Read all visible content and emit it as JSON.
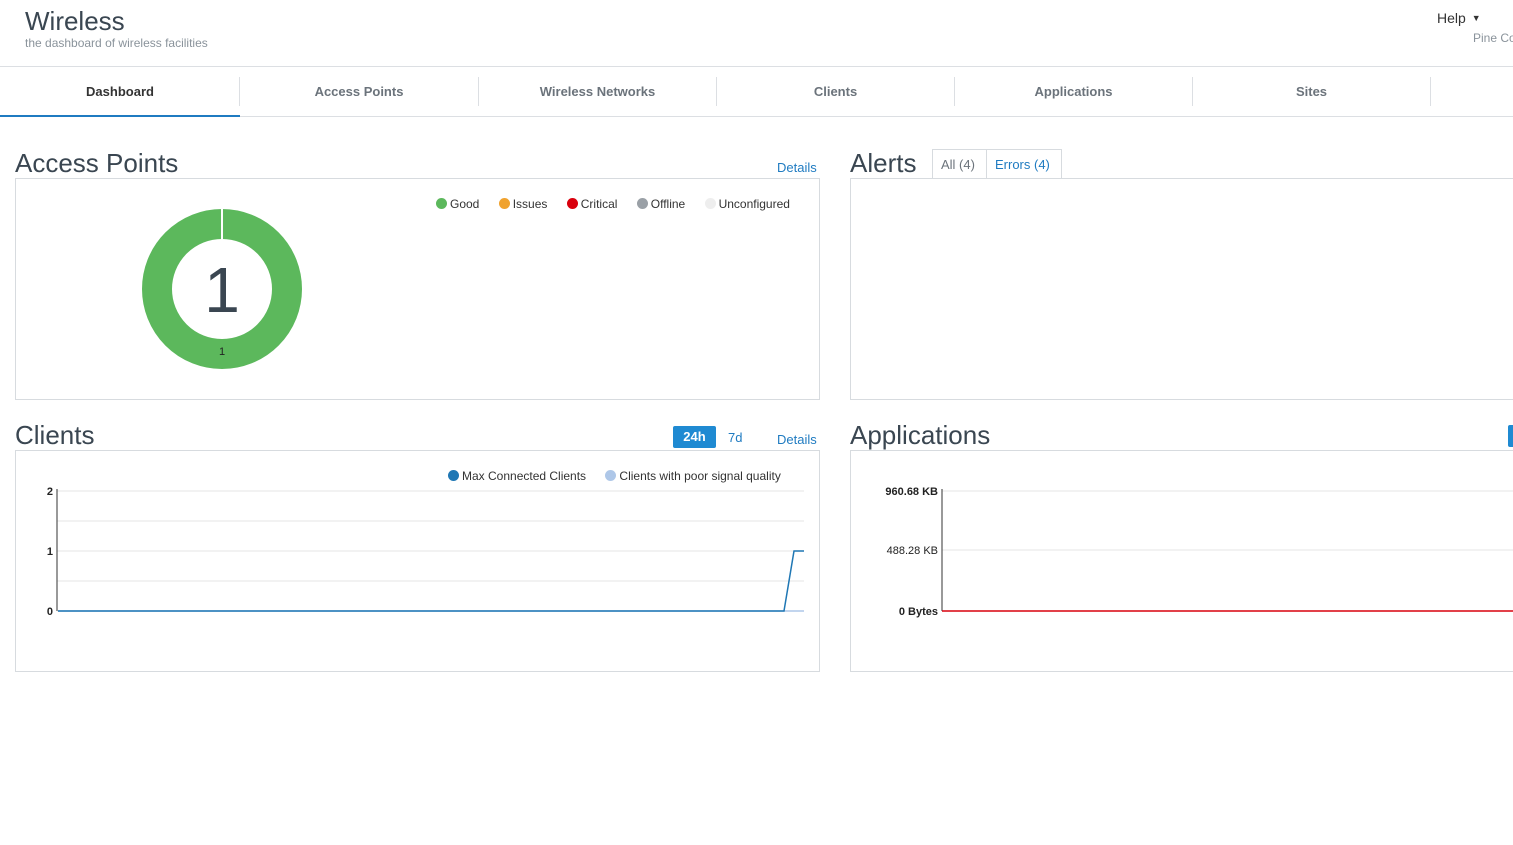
{
  "header": {
    "title": "Wireless",
    "subtitle": "the dashboard of wireless facilities",
    "help_label": "Help",
    "org_name": "Pine Co"
  },
  "tabs": [
    {
      "label": "Dashboard",
      "active": true
    },
    {
      "label": "Access Points",
      "active": false
    },
    {
      "label": "Wireless Networks",
      "active": false
    },
    {
      "label": "Clients",
      "active": false
    },
    {
      "label": "Applications",
      "active": false
    },
    {
      "label": "Sites",
      "active": false
    }
  ],
  "access_points": {
    "title": "Access Points",
    "details_label": "Details",
    "total": "1",
    "legend": [
      {
        "label": "Good",
        "color": "#5cb85c"
      },
      {
        "label": "Issues",
        "color": "#f0a22e"
      },
      {
        "label": "Critical",
        "color": "#d9000d"
      },
      {
        "label": "Offline",
        "color": "#9aa0a6"
      },
      {
        "label": "Unconfigured",
        "color": "#eeeeee"
      }
    ]
  },
  "alerts": {
    "title": "Alerts",
    "tab_all": "All (4)",
    "tab_errors": "Errors (4)"
  },
  "clients": {
    "title": "Clients",
    "range_24h": "24h",
    "range_7d": "7d",
    "details_label": "Details",
    "legend": [
      {
        "label": "Max Connected Clients",
        "color": "#1f77b4"
      },
      {
        "label": "Clients with poor signal quality",
        "color": "#aec7e8"
      }
    ]
  },
  "applications": {
    "title": "Applications"
  },
  "chart_data": [
    {
      "type": "pie",
      "categories": [
        "Good",
        "Issues",
        "Critical",
        "Offline",
        "Unconfigured"
      ],
      "values": [
        1,
        0,
        0,
        0,
        0
      ],
      "colors": [
        "#5cb85c",
        "#f0a22e",
        "#d9000d",
        "#9aa0a6",
        "#eeeeee"
      ],
      "center_label": "1",
      "slice_labels": [
        "1"
      ]
    },
    {
      "type": "line",
      "x": [
        0,
        1,
        2,
        3,
        4,
        5,
        6,
        7,
        8,
        9,
        10,
        11,
        12,
        13,
        14,
        15,
        16,
        17,
        18,
        19,
        20,
        21,
        22,
        23,
        24
      ],
      "series": [
        {
          "name": "Max Connected Clients",
          "color": "#1f77b4",
          "values": [
            0,
            0,
            0,
            0,
            0,
            0,
            0,
            0,
            0,
            0,
            0,
            0,
            0,
            0,
            0,
            0,
            0,
            0,
            0,
            0,
            0,
            0,
            0,
            0,
            1
          ]
        },
        {
          "name": "Clients with poor signal quality",
          "color": "#aec7e8",
          "values": [
            0,
            0,
            0,
            0,
            0,
            0,
            0,
            0,
            0,
            0,
            0,
            0,
            0,
            0,
            0,
            0,
            0,
            0,
            0,
            0,
            0,
            0,
            0,
            0,
            0
          ]
        }
      ],
      "yticks": [
        "0",
        "1",
        "2"
      ],
      "ylim": [
        0,
        2
      ],
      "grid": true
    },
    {
      "type": "line",
      "series": [
        {
          "color": "#d9000d",
          "values": [
            0,
            0
          ]
        }
      ],
      "yticks": [
        "0 Bytes",
        "488.28 KB",
        "960.68 KB"
      ],
      "grid": true
    }
  ]
}
